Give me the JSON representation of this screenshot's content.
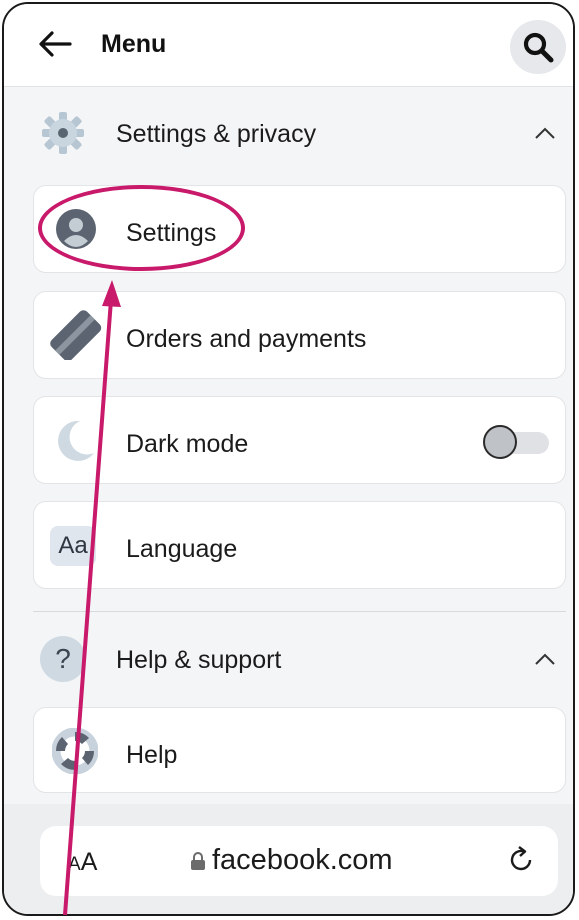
{
  "header": {
    "title": "Menu",
    "back_icon": "back-arrow-icon",
    "search_icon": "search-icon"
  },
  "settings_section": {
    "label": "Settings & privacy",
    "icon": "gear-icon",
    "expanded": true
  },
  "settings_items": [
    {
      "label": "Settings",
      "icon": "profile-icon"
    },
    {
      "label": "Orders and payments",
      "icon": "card-icon"
    },
    {
      "label": "Dark mode",
      "icon": "moon-icon",
      "toggle": false
    },
    {
      "label": "Language",
      "icon": "language-icon",
      "icon_text": "Aa"
    }
  ],
  "help_section": {
    "label": "Help & support",
    "icon": "question-icon",
    "icon_text": "?",
    "expanded": true
  },
  "help_items": [
    {
      "label": "Help",
      "icon": "lifebuoy-icon"
    }
  ],
  "address_bar": {
    "text_size_label_small": "A",
    "text_size_label_large": "A",
    "url": "facebook.com",
    "lock_icon": "lock-icon",
    "reload_icon": "reload-icon"
  },
  "colors": {
    "annotation": "#c8196b",
    "background": "#f4f5f7",
    "card": "#ffffff"
  }
}
